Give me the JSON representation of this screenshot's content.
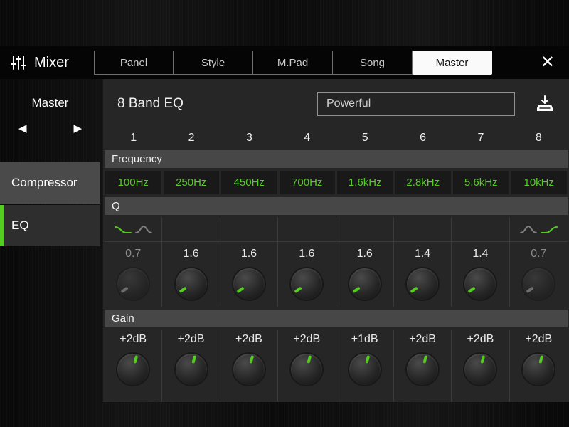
{
  "colors": {
    "accent_green": "#55CC22",
    "panel": "#262626",
    "section_bar": "#474747"
  },
  "header": {
    "title": "Mixer",
    "tabs": [
      "Panel",
      "Style",
      "M.Pad",
      "Song",
      "Master"
    ],
    "active_tab": "Master",
    "close_label": "✕"
  },
  "sidebar": {
    "channel_selector": {
      "label": "Master",
      "prev": "◀",
      "next": "▶"
    },
    "items": [
      {
        "label": "Compressor",
        "active": false
      },
      {
        "label": "EQ",
        "active": true
      }
    ]
  },
  "eq": {
    "title": "8 Band EQ",
    "preset": "Powerful",
    "band_numbers": [
      "1",
      "2",
      "3",
      "4",
      "5",
      "6",
      "7",
      "8"
    ],
    "frequency": {
      "label": "Frequency",
      "values": [
        "100Hz",
        "250Hz",
        "450Hz",
        "700Hz",
        "1.6kHz",
        "2.8kHz",
        "5.6kHz",
        "10kHz"
      ]
    },
    "q": {
      "label": "Q",
      "values": [
        "0.7",
        "1.6",
        "1.6",
        "1.6",
        "1.6",
        "1.4",
        "1.4",
        "0.7"
      ],
      "dimmed_bands": [
        "1",
        "8"
      ],
      "band1_filter_types": [
        "low-shelf",
        "peak"
      ],
      "band8_filter_types": [
        "peak",
        "high-shelf"
      ]
    },
    "gain": {
      "label": "Gain",
      "values": [
        "+2dB",
        "+2dB",
        "+2dB",
        "+2dB",
        "+1dB",
        "+2dB",
        "+2dB",
        "+2dB"
      ]
    }
  }
}
